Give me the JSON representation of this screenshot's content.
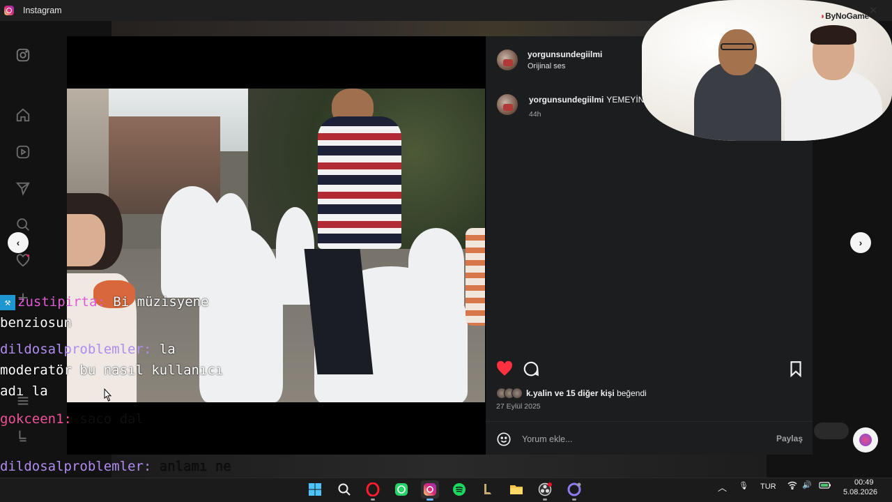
{
  "window": {
    "title": "Instagram"
  },
  "post": {
    "author": {
      "username": "yorgunsundegiilmi",
      "audio": "Orijinal ses"
    },
    "caption": {
      "username": "yorgunsundegiilmi",
      "text": "YEMEYİN",
      "time": "44h"
    },
    "likes": {
      "first_liker": "k.yalin",
      "text": " ve 15 diğer kişi",
      "suffix": " beğendi"
    },
    "date": "27 Eylül 2025",
    "comment": {
      "placeholder": "Yorum ekle...",
      "share_label": "Paylaş"
    },
    "liked": true,
    "like_color": "#ff3040"
  },
  "webcam": {
    "logo": "ByNoGame"
  },
  "chat": [
    {
      "user": "zustipirta:",
      "message": " Bi müzisyene benziosun",
      "name_color": "#e05ad6",
      "badge": "moderator",
      "message_dark": false
    },
    {
      "user": "dildosalproblemler:",
      "message": " la moderatör bu nasıl kullanıcı adı la",
      "name_color": "#b08cf0",
      "message_dark": false
    },
    {
      "user": "gokceen1:",
      "message": " saco dal",
      "name_color": "#f0509a",
      "message_dark": true
    },
    {
      "user": "dildosalproblemler:",
      "message": " anlamı ne bunun",
      "name_color": "#b08cf0",
      "message_dark": true
    }
  ],
  "taskbar": {
    "language": "TUR",
    "time": "00:49",
    "date": "5.08.2026",
    "apps": [
      "start-icon",
      "search-icon",
      "opera-icon",
      "whatsapp-icon",
      "instagram-icon",
      "spotify-icon",
      "league-icon",
      "file-explorer-icon",
      "obs-icon",
      "app-icon"
    ]
  }
}
